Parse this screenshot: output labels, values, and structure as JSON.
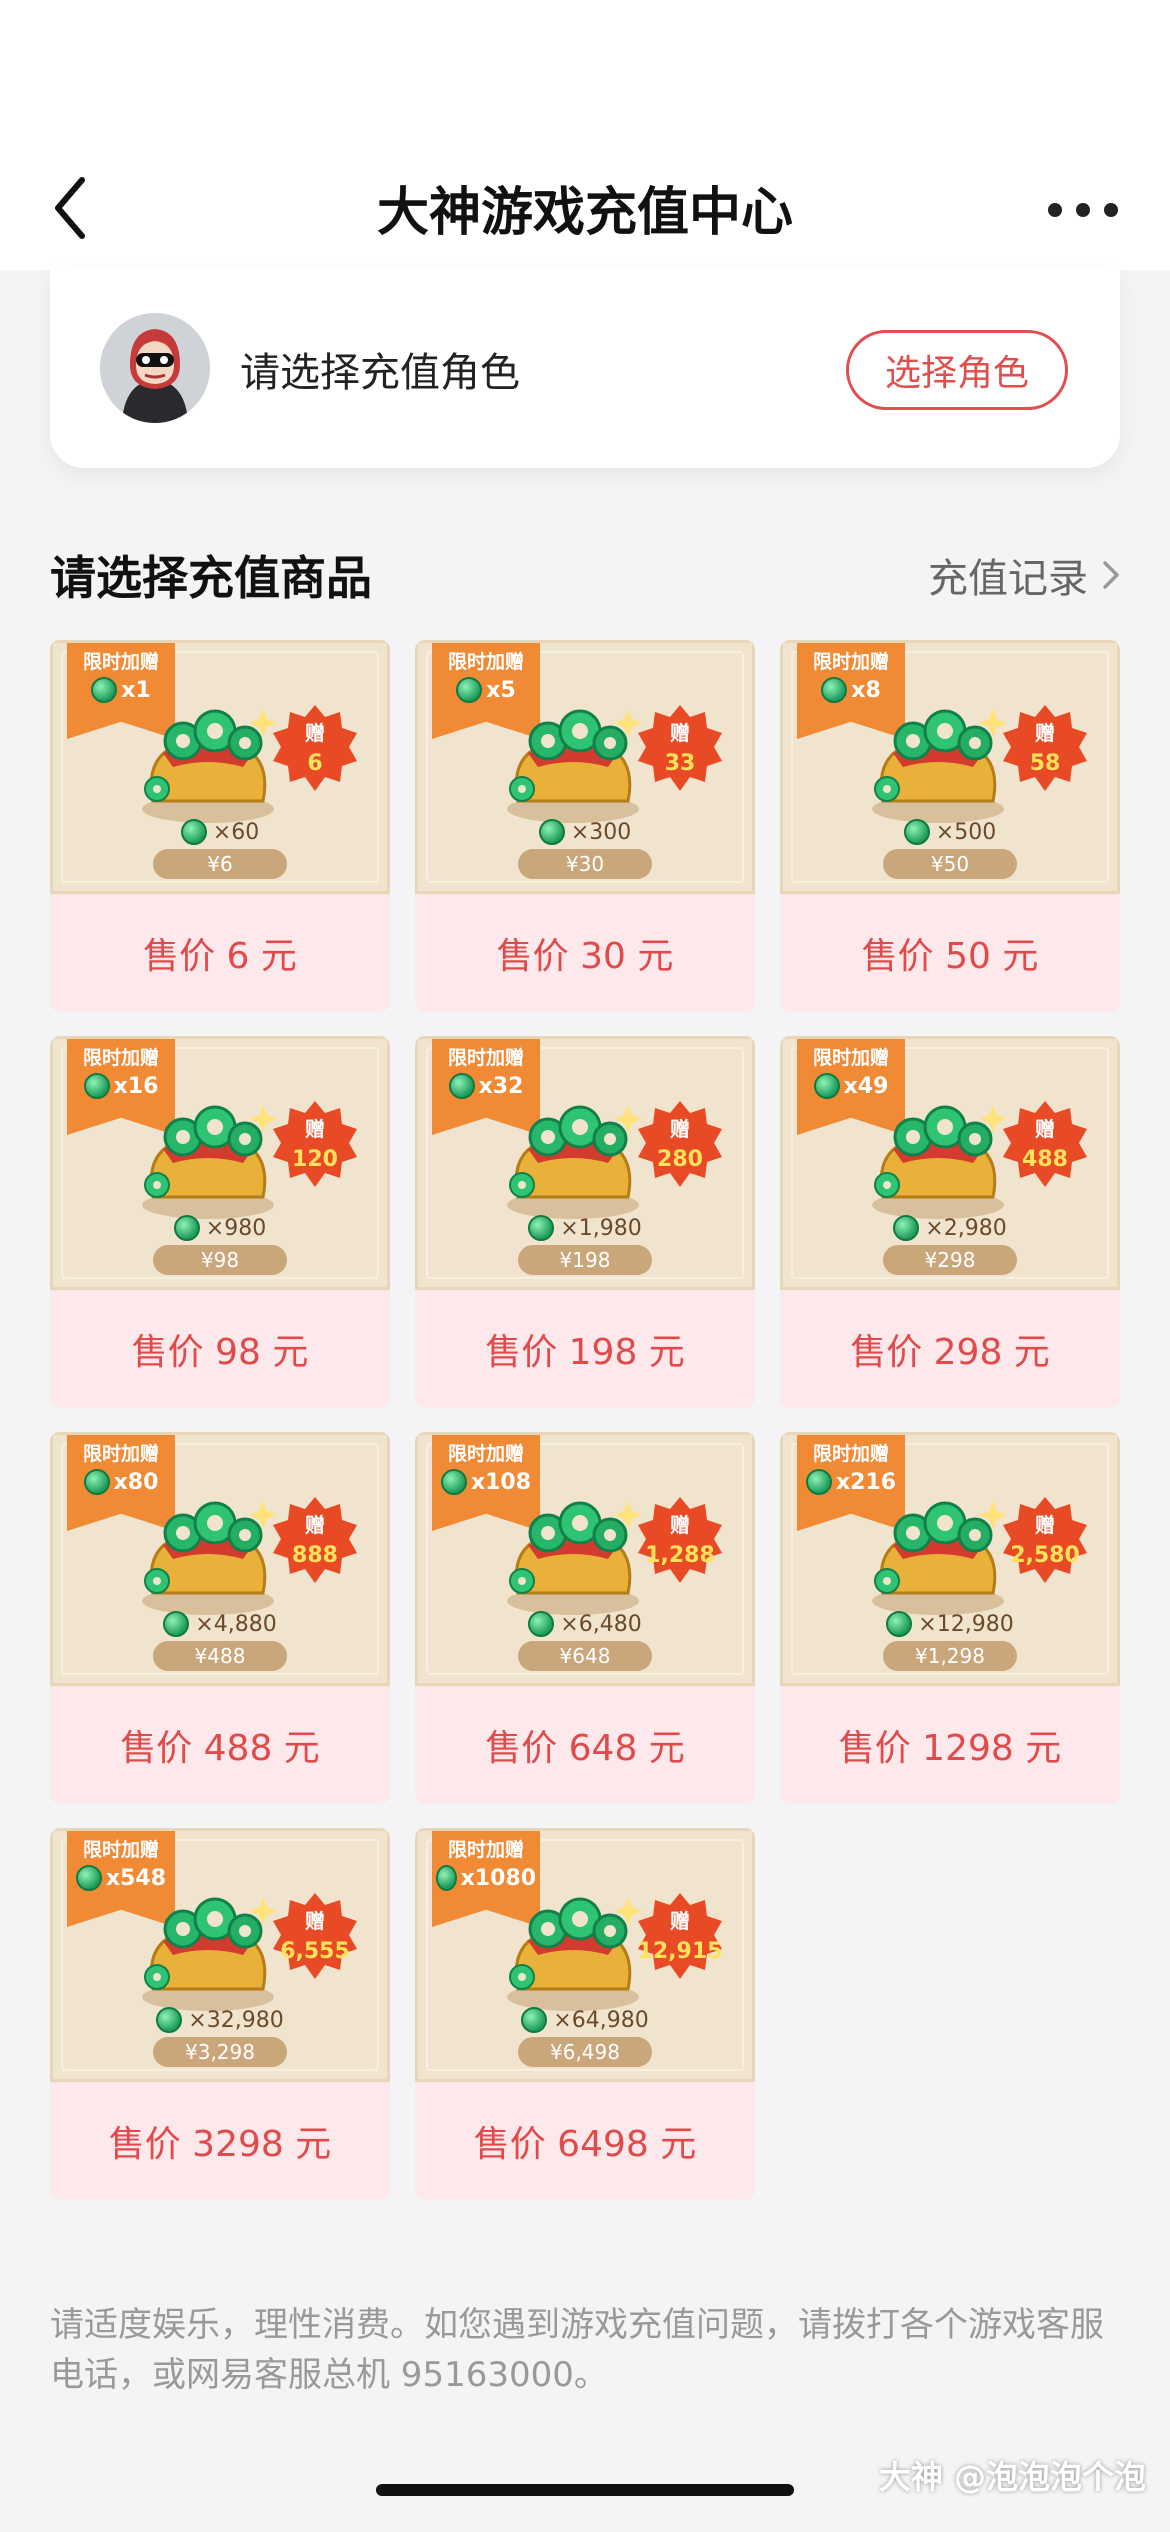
{
  "header": {
    "title": "大神游戏充值中心"
  },
  "role": {
    "label": "请选择充值角色",
    "button": "选择角色"
  },
  "section": {
    "title": "请选择充值商品",
    "records": "充值记录"
  },
  "colors": {
    "accent": "#e24d4d",
    "tag": "#f08a34",
    "jade": "#1e9c5a"
  },
  "products": [
    {
      "tag": "限时加赠",
      "mult": "x1",
      "bonus_label": "赠",
      "bonus": "6",
      "qty": "×60",
      "price_pill": "¥6",
      "sale": "售价 6 元"
    },
    {
      "tag": "限时加赠",
      "mult": "x5",
      "bonus_label": "赠",
      "bonus": "33",
      "qty": "×300",
      "price_pill": "¥30",
      "sale": "售价 30 元"
    },
    {
      "tag": "限时加赠",
      "mult": "x8",
      "bonus_label": "赠",
      "bonus": "58",
      "qty": "×500",
      "price_pill": "¥50",
      "sale": "售价 50 元"
    },
    {
      "tag": "限时加赠",
      "mult": "x16",
      "bonus_label": "赠",
      "bonus": "120",
      "qty": "×980",
      "price_pill": "¥98",
      "sale": "售价 98 元"
    },
    {
      "tag": "限时加赠",
      "mult": "x32",
      "bonus_label": "赠",
      "bonus": "280",
      "qty": "×1,980",
      "price_pill": "¥198",
      "sale": "售价 198 元"
    },
    {
      "tag": "限时加赠",
      "mult": "x49",
      "bonus_label": "赠",
      "bonus": "488",
      "qty": "×2,980",
      "price_pill": "¥298",
      "sale": "售价 298 元"
    },
    {
      "tag": "限时加赠",
      "mult": "x80",
      "bonus_label": "赠",
      "bonus": "888",
      "qty": "×4,880",
      "price_pill": "¥488",
      "sale": "售价 488 元"
    },
    {
      "tag": "限时加赠",
      "mult": "x108",
      "bonus_label": "赠",
      "bonus": "1,288",
      "qty": "×6,480",
      "price_pill": "¥648",
      "sale": "售价 648 元"
    },
    {
      "tag": "限时加赠",
      "mult": "x216",
      "bonus_label": "赠",
      "bonus": "2,580",
      "qty": "×12,980",
      "price_pill": "¥1,298",
      "sale": "售价 1298 元"
    },
    {
      "tag": "限时加赠",
      "mult": "x548",
      "bonus_label": "赠",
      "bonus": "6,555",
      "qty": "×32,980",
      "price_pill": "¥3,298",
      "sale": "售价 3298 元"
    },
    {
      "tag": "限时加赠",
      "mult": "x1080",
      "bonus_label": "赠",
      "bonus": "12,915",
      "qty": "×64,980",
      "price_pill": "¥6,498",
      "sale": "售价 6498 元"
    }
  ],
  "notice": "请适度娱乐，理性消费。如您遇到游戏充值问题，请拨打各个游戏客服电话，或网易客服总机 95163000。",
  "watermark": "大神 @泡泡泡个泡"
}
